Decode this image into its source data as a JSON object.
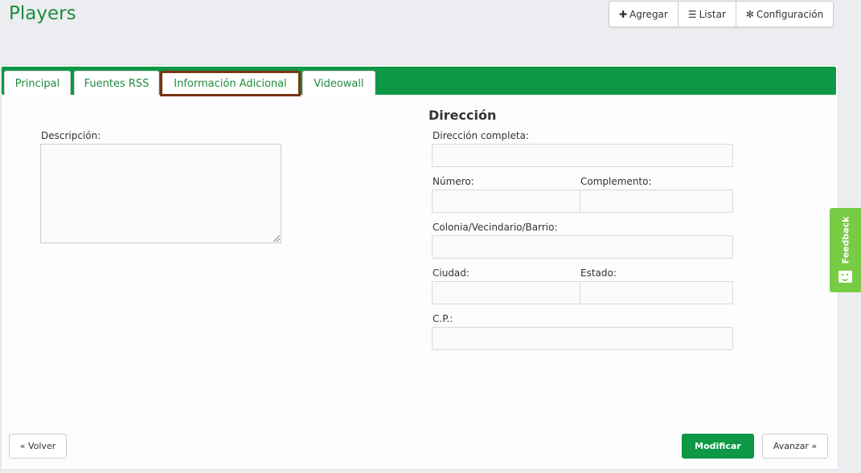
{
  "page": {
    "title": "Players"
  },
  "toolbar": {
    "add_label": "Agregar",
    "list_label": "Listar",
    "config_label": "Configuración",
    "add_icon": "plus-icon",
    "list_icon": "list-icon",
    "config_icon": "gear-icon"
  },
  "tabs": [
    {
      "label": "Principal"
    },
    {
      "label": "Fuentes RSS"
    },
    {
      "label": "Información Adicional",
      "active": true
    },
    {
      "label": "Videowall"
    }
  ],
  "form": {
    "description_label": "Descripción:",
    "description_value": "",
    "address_section_title": "Dirección",
    "full_address_label": "Dirección completa:",
    "full_address_value": "",
    "number_label": "Número:",
    "number_value": "",
    "complement_label": "Complemento:",
    "complement_value": "",
    "neighborhood_label": "Colonia/Vecindario/Barrio:",
    "neighborhood_value": "",
    "city_label": "Ciudad:",
    "city_value": "",
    "state_label": "Estado:",
    "state_value": "",
    "zip_label": "C.P.:",
    "zip_value": ""
  },
  "actions": {
    "back_label": "« Volver",
    "modify_label": "Modificar",
    "next_label": "Avanzar »"
  },
  "feedback": {
    "label": "Feedback"
  },
  "colors": {
    "brand_green": "#0c9845",
    "title_green": "#1e8c3c",
    "active_tab_border": "#7a3410",
    "feedback_green": "#77cc44"
  }
}
